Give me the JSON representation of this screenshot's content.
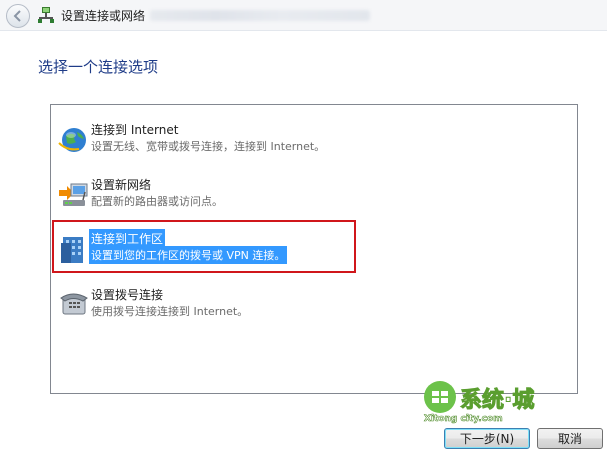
{
  "window": {
    "title": "设置连接或网络"
  },
  "page": {
    "heading": "选择一个连接选项"
  },
  "options": [
    {
      "title": "连接到 Internet",
      "description": "设置无线、宽带或拨号连接，连接到 Internet。",
      "icon": "internet-globe-icon",
      "selected": false
    },
    {
      "title": "设置新网络",
      "description": "配置新的路由器或访问点。",
      "icon": "new-network-icon",
      "selected": false
    },
    {
      "title": "连接到工作区",
      "description": "设置到您的工作区的拨号或 VPN 连接。",
      "icon": "workplace-icon",
      "selected": true
    },
    {
      "title": "设置拨号连接",
      "description": "使用拨号连接连接到 Internet。",
      "icon": "dialup-phone-icon",
      "selected": false
    }
  ],
  "buttons": {
    "next": "下一步(N)",
    "cancel": "取消"
  },
  "watermark": {
    "brand": "系统城",
    "url": "Xitong city.com"
  },
  "colors": {
    "heading": "#1f3c88",
    "selection": "#3399ff",
    "highlight_box": "#d0161b"
  }
}
